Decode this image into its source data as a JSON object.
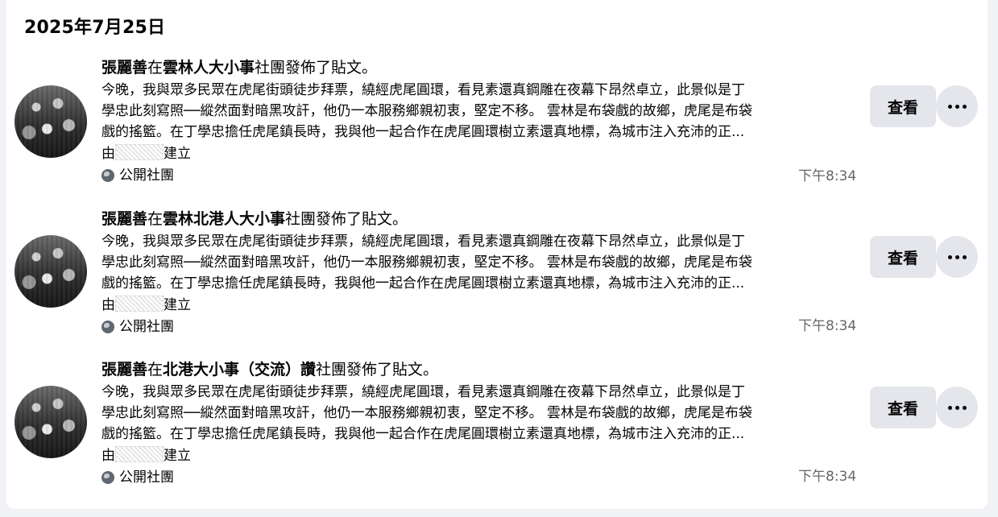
{
  "date_header": "2025年7月25日",
  "posts": [
    {
      "author": "張麗善",
      "connector": "在",
      "group": "雲林人大小事",
      "suffix": "社團發佈了貼文。",
      "lines": [
        "今晚，我與眾多民眾在虎尾街頭徒步拜票，繞經虎尾圓環，看見素還真鋼雕在夜幕下昂然卓立，此景似是丁",
        "學忠此刻寫照──縱然面對暗黑攻訐，他仍一本服務鄉親初衷，堅定不移。 雲林是布袋戲的故鄉，虎尾是布袋",
        "戲的搖籃。在丁學忠擔任虎尾鎮長時，我與他一起合作在虎尾圓環樹立素還真地標，為城市注入充沛的正..."
      ],
      "creator_prefix": "由",
      "creator_suffix": "建立",
      "privacy": "公開社團",
      "time": "下午8:34",
      "view_label": "查看"
    },
    {
      "author": "張麗善",
      "connector": "在",
      "group": "雲林北港人大小事",
      "suffix": "社團發佈了貼文。",
      "lines": [
        "今晚，我與眾多民眾在虎尾街頭徒步拜票，繞經虎尾圓環，看見素還真鋼雕在夜幕下昂然卓立，此景似是丁",
        "學忠此刻寫照──縱然面對暗黑攻訐，他仍一本服務鄉親初衷，堅定不移。 雲林是布袋戲的故鄉，虎尾是布袋",
        "戲的搖籃。在丁學忠擔任虎尾鎮長時，我與他一起合作在虎尾圓環樹立素還真地標，為城市注入充沛的正..."
      ],
      "creator_prefix": "由",
      "creator_suffix": "建立",
      "privacy": "公開社團",
      "time": "下午8:34",
      "view_label": "查看"
    },
    {
      "author": "張麗善",
      "connector": "在",
      "group": "北港大小事（交流）讚",
      "suffix": "社團發佈了貼文。",
      "lines": [
        "今晚，我與眾多民眾在虎尾街頭徒步拜票，繞經虎尾圓環，看見素還真鋼雕在夜幕下昂然卓立，此景似是丁",
        "學忠此刻寫照──縱然面對暗黑攻訐，他仍一本服務鄉親初衷，堅定不移。 雲林是布袋戲的故鄉，虎尾是布袋",
        "戲的搖籃。在丁學忠擔任虎尾鎮長時，我與他一起合作在虎尾圓環樹立素還真地標，為城市注入充沛的正..."
      ],
      "creator_prefix": "由",
      "creator_suffix": "建立",
      "privacy": "公開社團",
      "time": "下午8:34",
      "view_label": "查看"
    }
  ],
  "icons": {
    "privacy": "globe-icon",
    "more": "more-options-icon"
  }
}
